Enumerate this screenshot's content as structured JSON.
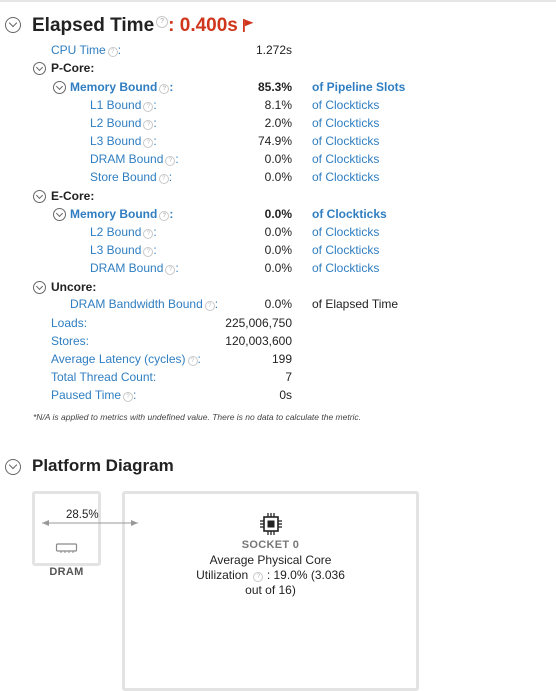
{
  "elapsed": {
    "title": "Elapsed Time",
    "sep": ":",
    "value": "0.400s",
    "accent": "#d0361c"
  },
  "cpu_time": {
    "label": "CPU Time",
    "value": "1.272s"
  },
  "pcore": {
    "label": "P-Core:",
    "memory_bound": {
      "label": "Memory Bound",
      "value": "85.3%",
      "unit": "of Pipeline Slots"
    },
    "rows": [
      {
        "label": "L1 Bound",
        "value": "8.1%",
        "unit": "of Clockticks"
      },
      {
        "label": "L2 Bound",
        "value": "2.0%",
        "unit": "of Clockticks"
      },
      {
        "label": "L3 Bound",
        "value": "74.9%",
        "unit": "of Clockticks"
      },
      {
        "label": "DRAM Bound",
        "value": "0.0%",
        "unit": "of Clockticks"
      },
      {
        "label": "Store Bound",
        "value": "0.0%",
        "unit": "of Clockticks"
      }
    ]
  },
  "ecore": {
    "label": "E-Core:",
    "memory_bound": {
      "label": "Memory Bound",
      "value": "0.0%",
      "unit": "of Clockticks"
    },
    "rows": [
      {
        "label": "L2 Bound",
        "value": "0.0%",
        "unit": "of Clockticks"
      },
      {
        "label": "L3 Bound",
        "value": "0.0%",
        "unit": "of Clockticks"
      },
      {
        "label": "DRAM Bound",
        "value": "0.0%",
        "unit": "of Clockticks"
      }
    ]
  },
  "uncore": {
    "label": "Uncore:",
    "dram_bw": {
      "label": "DRAM Bandwidth Bound",
      "value": "0.0%",
      "unit": "of Elapsed Time"
    }
  },
  "totals": [
    {
      "label": "Loads:",
      "value": "225,006,750"
    },
    {
      "label": "Stores:",
      "value": "120,003,600"
    },
    {
      "label": "Average Latency (cycles)",
      "value": "199"
    },
    {
      "label": "Total Thread Count:",
      "value": "7"
    },
    {
      "label": "Paused Time",
      "value": "0s"
    }
  ],
  "footnote": "*N/A is applied to metrics with undefined value. There is no data to calculate the metric.",
  "platform": {
    "title": "Platform Diagram",
    "dram_label": "DRAM",
    "link_value": "28.5%",
    "socket_label": "SOCKET 0",
    "util_line1": "Average Physical Core",
    "util_line2_a": "Utilization",
    "util_line2_b": ": 19.0% (3.036",
    "util_line3": "out of 16)"
  },
  "icons": [
    "collapse-icon",
    "help-icon",
    "flag-icon",
    "memory-icon",
    "cpu-icon"
  ]
}
